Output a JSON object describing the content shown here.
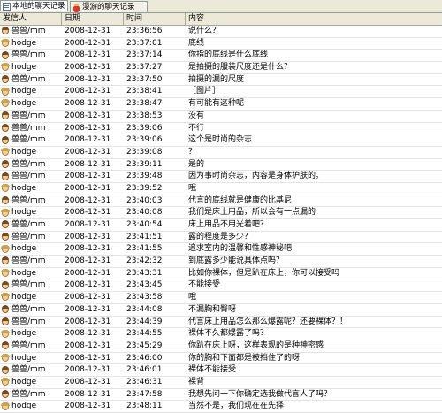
{
  "tabs": [
    {
      "label": "本地的聊天记录",
      "icon": "document-icon"
    },
    {
      "label": "漫游的聊天记录",
      "icon": "roaming-bag-icon"
    }
  ],
  "columns": [
    "发信人",
    "日期",
    "时间",
    "内容"
  ],
  "rows": [
    {
      "sender": "兽兽/mm",
      "avatar": "a",
      "date": "2008-12-31",
      "time": "23:36:56",
      "content": "说什么？"
    },
    {
      "sender": "hodge",
      "avatar": "b",
      "date": "2008-12-31",
      "time": "23:37:01",
      "content": "底线"
    },
    {
      "sender": "兽兽/mm",
      "avatar": "a",
      "date": "2008-12-31",
      "time": "23:37:14",
      "content": "你指的底线是什么底线"
    },
    {
      "sender": "hodge",
      "avatar": "b",
      "date": "2008-12-31",
      "time": "23:37:27",
      "content": "是拍摄的服装尺度还是什么？"
    },
    {
      "sender": "兽兽/mm",
      "avatar": "a",
      "date": "2008-12-31",
      "time": "23:37:50",
      "content": "拍摄的漏的尺度"
    },
    {
      "sender": "hodge",
      "avatar": "b",
      "date": "2008-12-31",
      "time": "23:38:41",
      "content": "［图片］"
    },
    {
      "sender": "hodge",
      "avatar": "b",
      "date": "2008-12-31",
      "time": "23:38:47",
      "content": "有可能有这种呢"
    },
    {
      "sender": "兽兽/mm",
      "avatar": "a",
      "date": "2008-12-31",
      "time": "23:38:53",
      "content": "没有"
    },
    {
      "sender": "兽兽/mm",
      "avatar": "a",
      "date": "2008-12-31",
      "time": "23:39:06",
      "content": "不行"
    },
    {
      "sender": "兽兽/mm",
      "avatar": "a",
      "date": "2008-12-31",
      "time": "23:39:06",
      "content": "这个是时尚的杂志"
    },
    {
      "sender": "hodge",
      "avatar": "b",
      "date": "2008-12-31",
      "time": "23:39:08",
      "content": "？"
    },
    {
      "sender": "兽兽/mm",
      "avatar": "a",
      "date": "2008-12-31",
      "time": "23:39:11",
      "content": "是的"
    },
    {
      "sender": "兽兽/mm",
      "avatar": "a",
      "date": "2008-12-31",
      "time": "23:39:48",
      "content": "因为事时尚杂志，内容是身体护肤的。"
    },
    {
      "sender": "hodge",
      "avatar": "b",
      "date": "2008-12-31",
      "time": "23:39:52",
      "content": "哦"
    },
    {
      "sender": "兽兽/mm",
      "avatar": "a",
      "date": "2008-12-31",
      "time": "23:40:03",
      "content": "代言的底线就是健康的比基尼"
    },
    {
      "sender": "hodge",
      "avatar": "b",
      "date": "2008-12-31",
      "time": "23:40:08",
      "content": "我们是床上用品，所以会有一点漏的"
    },
    {
      "sender": "兽兽/mm",
      "avatar": "a",
      "date": "2008-12-31",
      "time": "23:40:54",
      "content": "床上用品不用光着吧？"
    },
    {
      "sender": "兽兽/mm",
      "avatar": "a",
      "date": "2008-12-31",
      "time": "23:41:51",
      "content": "露的程度是多少？"
    },
    {
      "sender": "hodge",
      "avatar": "b",
      "date": "2008-12-31",
      "time": "23:41:55",
      "content": "追求室内的温馨和性感神秘吧"
    },
    {
      "sender": "兽兽/mm",
      "avatar": "a",
      "date": "2008-12-31",
      "time": "23:42:32",
      "content": "到底露多少能说具体点吗？"
    },
    {
      "sender": "hodge",
      "avatar": "b",
      "date": "2008-12-31",
      "time": "23:43:31",
      "content": "比如你裸体，但是趴在床上，你可以接受吗"
    },
    {
      "sender": "兽兽/mm",
      "avatar": "a",
      "date": "2008-12-31",
      "time": "23:43:45",
      "content": "不能接受"
    },
    {
      "sender": "hodge",
      "avatar": "b",
      "date": "2008-12-31",
      "time": "23:43:58",
      "content": "哦"
    },
    {
      "sender": "兽兽/mm",
      "avatar": "a",
      "date": "2008-12-31",
      "time": "23:44:08",
      "content": "不漏胸和臀呀"
    },
    {
      "sender": "兽兽/mm",
      "avatar": "a",
      "date": "2008-12-31",
      "time": "23:44:39",
      "content": "代言床上用品怎么那么爆露呢？还要裸体？！"
    },
    {
      "sender": "hodge",
      "avatar": "b",
      "date": "2008-12-31",
      "time": "23:44:55",
      "content": "裸体不久都爆露了吗？"
    },
    {
      "sender": "兽兽/mm",
      "avatar": "a",
      "date": "2008-12-31",
      "time": "23:45:29",
      "content": "你趴在床上呀，这样表现的是种神密感"
    },
    {
      "sender": "hodge",
      "avatar": "b",
      "date": "2008-12-31",
      "time": "23:46:00",
      "content": "你的胸和下面都是被挡住了的呀"
    },
    {
      "sender": "兽兽/mm",
      "avatar": "a",
      "date": "2008-12-31",
      "time": "23:46:01",
      "content": "裸体不能接受"
    },
    {
      "sender": "hodge",
      "avatar": "b",
      "date": "2008-12-31",
      "time": "23:46:31",
      "content": "裸背"
    },
    {
      "sender": "兽兽/mm",
      "avatar": "a",
      "date": "2008-12-31",
      "time": "23:47:58",
      "content": "我想先问一下你确定选我做代言人了吗？"
    },
    {
      "sender": "hodge",
      "avatar": "b",
      "date": "2008-12-31",
      "time": "23:48:11",
      "content": "当然不是，我们现在在先择"
    }
  ]
}
